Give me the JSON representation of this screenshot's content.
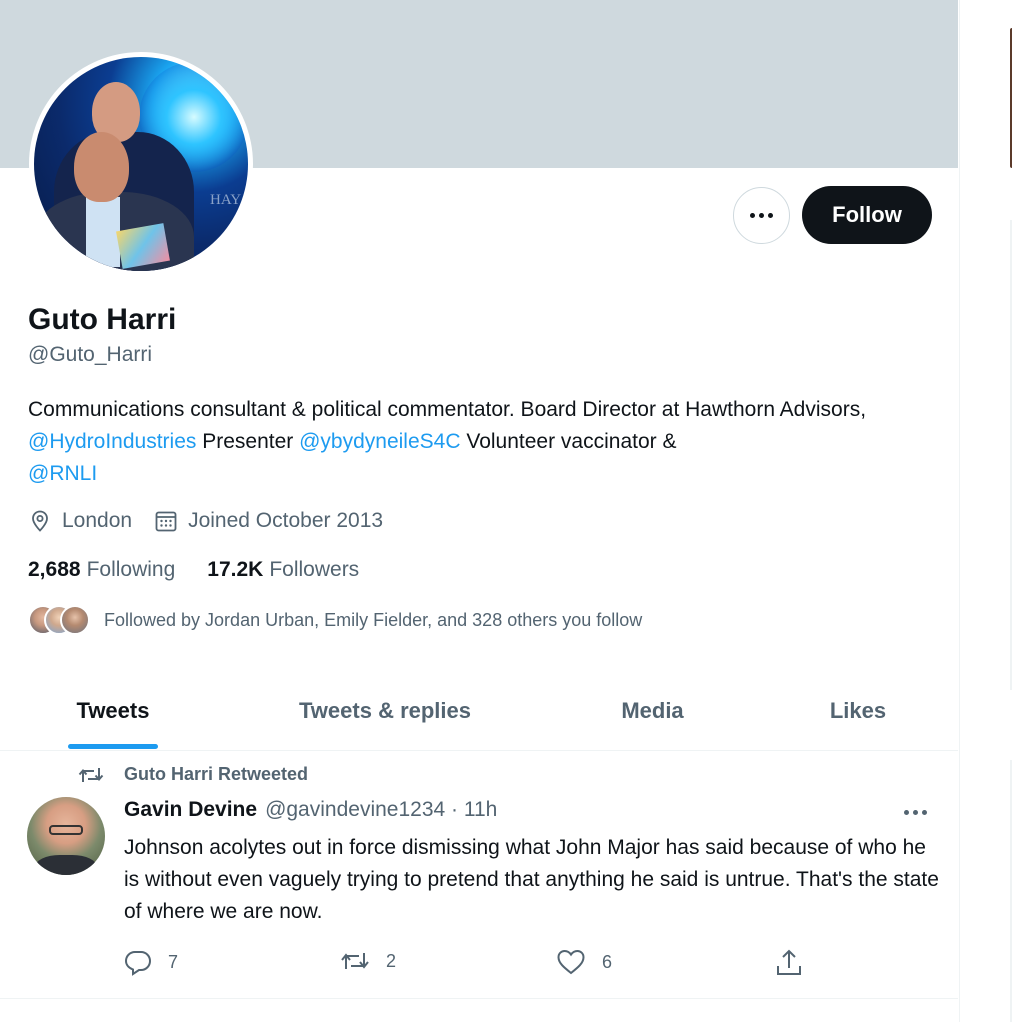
{
  "profile": {
    "name": "Guto Harri",
    "handle": "@Guto_Harri",
    "bio": {
      "part1": "Communications consultant & political commentator. Board Director at Hawthorn Advisors, ",
      "link1": "@HydroIndustries",
      "part2": " Presenter ",
      "link2": "@ybydyneileS4C",
      "part3": " Volunteer vaccinator & ",
      "link3": "@RNLI"
    },
    "location": "London",
    "joined": "Joined October 2013",
    "following_count": "2,688",
    "following_label": "Following",
    "followers_count": "17.2K",
    "followers_label": "Followers",
    "followed_by": "Followed by Jordan Urban, Emily Fielder, and 328 others you follow",
    "avatar_photo_text": "HAY"
  },
  "actions": {
    "follow_label": "Follow"
  },
  "tabs": [
    {
      "label": "Tweets",
      "active": true
    },
    {
      "label": "Tweets & replies",
      "active": false
    },
    {
      "label": "Media",
      "active": false
    },
    {
      "label": "Likes",
      "active": false
    }
  ],
  "tweet": {
    "retweeted_by": "Guto Harri Retweeted",
    "author_name": "Gavin Devine",
    "author_handle": "@gavindevine1234 · 11h",
    "text": "Johnson acolytes out in force dismissing what John Major has said because of who he is without even vaguely trying to pretend that anything he said is untrue. That's the state of where we are now.",
    "replies": "7",
    "retweets": "2",
    "likes": "6"
  },
  "icons": {
    "location": "location-pin-icon",
    "calendar": "calendar-icon",
    "reply": "reply-icon",
    "retweet": "retweet-icon",
    "like": "heart-icon",
    "share": "share-icon",
    "more": "more-icon"
  },
  "colors": {
    "accent": "#1d9bf0",
    "banner": "#cfd9de",
    "text_primary": "#0f1419",
    "text_secondary": "#536471"
  }
}
